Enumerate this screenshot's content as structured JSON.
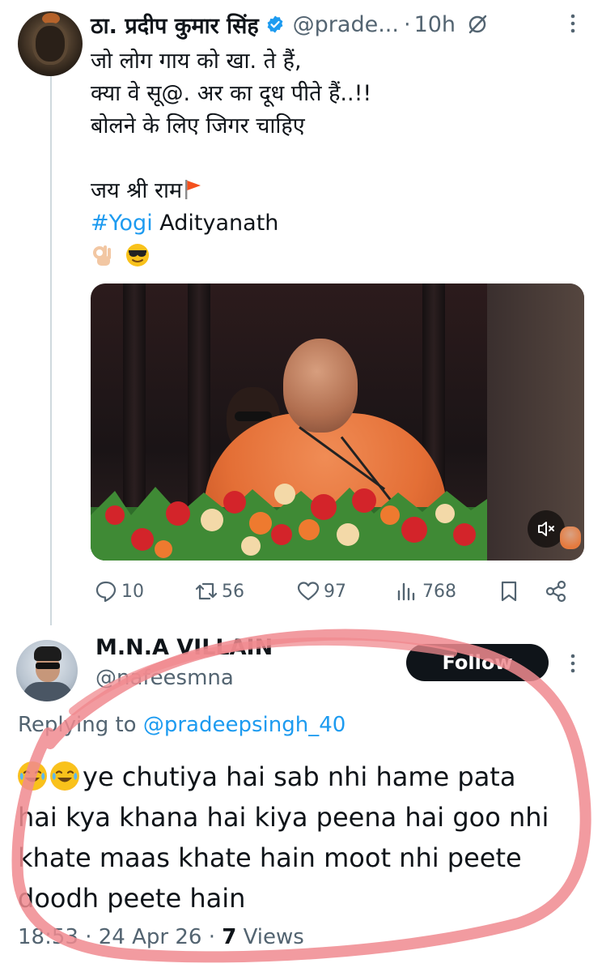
{
  "parent_tweet": {
    "author_name": "ठा. प्रदीप कुमार सिंह",
    "handle": "@prade...",
    "separator": "·",
    "time": "10h",
    "text_lines": [
      "जो लोग गाय को खा. ते हैं,",
      "क्या वे सू@. अर का दूध पीते हैं..!!",
      "बोलने के लिए जिगर चाहिए"
    ],
    "jai_line": "जय श्री राम",
    "hashtag": "#Yogi",
    "hashtag_rest": " Adityanath",
    "icons": {
      "verified": "verified-badge-icon",
      "grok": "grok-icon",
      "more": "more-vertical-icon",
      "flag": "saffron-flag-emoji",
      "ok_hand": "ok-hand-emoji",
      "sunglasses": "sunglasses-emoji",
      "mute": "speaker-muted-icon"
    },
    "stats": {
      "replies": "10",
      "reposts": "56",
      "likes": "97",
      "views": "768"
    }
  },
  "reply_tweet": {
    "author_name": "M.N.A VILLAIN",
    "handle": "@nafeesmna",
    "follow_label": "Follow",
    "replying_prefix": "Replying to ",
    "replying_to": "@pradeepsingh_40",
    "text_lines": [
      "ye chutiya hai sab nhi hame pata",
      "hai kya khana hai kiya peena hai goo nhi",
      "khate maas khate hain moot nhi peete",
      "doodh peete hain"
    ],
    "leading_emojis": "tears-of-joy-emoji",
    "time": "18:53",
    "separator": "·",
    "date": "24 Apr 26",
    "views_count": "7",
    "views_label": "Views"
  },
  "colors": {
    "text": "#0f1419",
    "secondary": "#536471",
    "link": "#1d9bf0",
    "verified": "#1d9bf0",
    "follow_bg": "#0f1419",
    "annotation": "#f08a8f"
  }
}
